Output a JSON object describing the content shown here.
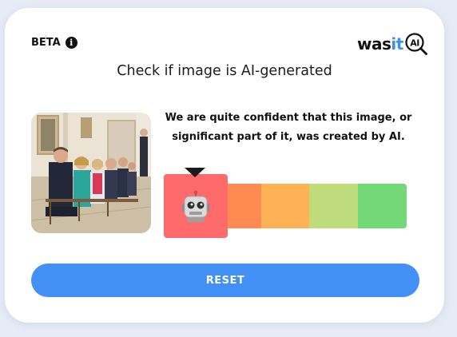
{
  "header": {
    "badge": "BETA",
    "info_icon": "info-icon",
    "logo_word_prefix": "was",
    "logo_word_accent": "it",
    "logo_mark_text": "AI"
  },
  "title": "Check if image is AI-generated",
  "image": {
    "description_icon": "photo-thumbnail"
  },
  "result": {
    "line1": "We are quite confident that this image, or",
    "line2": "significant part of it, was created by AI."
  },
  "meter": {
    "segments": [
      {
        "color": "#ff6b6b",
        "level": "ai"
      },
      {
        "color": "#ff8b52",
        "level": "likely-ai"
      },
      {
        "color": "#ffb155",
        "level": "uncertain"
      },
      {
        "color": "#bfdc7d",
        "level": "likely-human"
      },
      {
        "color": "#73d877",
        "level": "human"
      }
    ],
    "selected_index": 0,
    "selected_icon": "robot-icon"
  },
  "actions": {
    "reset_label": "RESET"
  },
  "colors": {
    "accent": "#428ff5",
    "logo_accent": "#3d8ff0"
  }
}
